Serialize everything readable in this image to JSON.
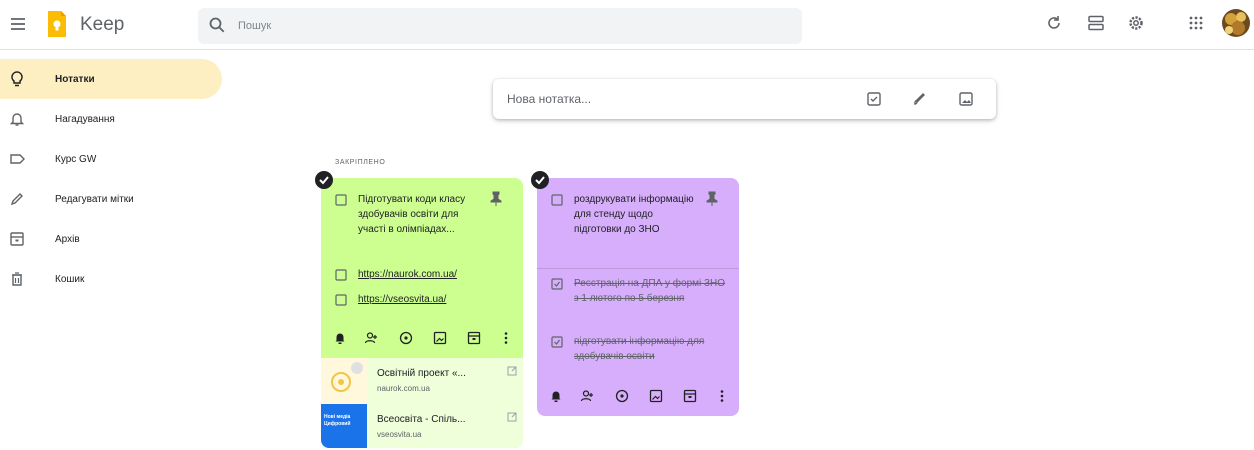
{
  "app": {
    "logo_text": "Keep"
  },
  "search": {
    "placeholder": "Пошук"
  },
  "sidebar": {
    "items": [
      {
        "label": "Нотатки",
        "icon": "lightbulb-icon",
        "active": true
      },
      {
        "label": "Нагадування",
        "icon": "bell-icon"
      },
      {
        "label": "Курс GW",
        "icon": "label-icon"
      },
      {
        "label": "Редагувати мітки",
        "icon": "pencil-icon"
      },
      {
        "label": "Архів",
        "icon": "archive-icon"
      },
      {
        "label": "Кошик",
        "icon": "trash-icon"
      }
    ]
  },
  "take_note": {
    "placeholder": "Нова нотатка..."
  },
  "pinned_label": "ЗАКРІПЛЕНО",
  "notes": [
    {
      "color": "#ccff90",
      "items": [
        {
          "text": "Підготувати коди класу здобувачів освіти для участі в олімпіадах...",
          "checked": false
        },
        {
          "text": "https://naurok.com.ua/",
          "checked": false,
          "link": true
        },
        {
          "text": "https://vseosvita.ua/",
          "checked": false,
          "link": true
        }
      ],
      "previews": [
        {
          "title": "Освітній проект «...",
          "domain": "naurok.com.ua"
        },
        {
          "title": "Всеосвіта - Спіль...",
          "domain": "vseosvita.ua",
          "thumb_text": "Нові медіа Цифровий"
        }
      ]
    },
    {
      "color": "#d7aefb",
      "items": [
        {
          "text": "роздрукувати інформацію для стенду щодо підготовки до ЗНО",
          "checked": false
        }
      ],
      "done_items": [
        {
          "text": "Реєстрація на ДПА у формі ЗНО з 1 лютого по 5 березня",
          "checked": true
        },
        {
          "text": "підготувати інформацію для здобувачів освіти",
          "checked": true
        }
      ]
    }
  ],
  "colors": {
    "accent": "#feefc3",
    "logo": "#fbbc04"
  }
}
